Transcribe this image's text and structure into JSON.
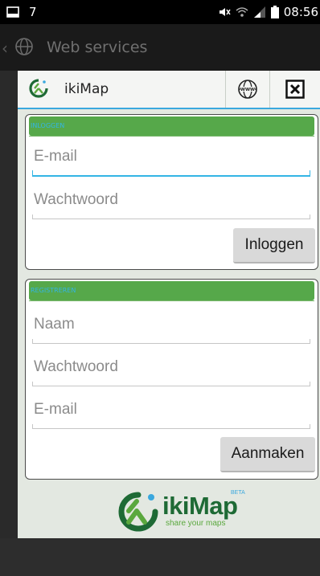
{
  "status_bar": {
    "left_text": "7",
    "time": "08:56",
    "icons": [
      "screenshot-icon",
      "mute-icon",
      "wifi-icon",
      "signal-icon",
      "battery-icon"
    ]
  },
  "action_bar": {
    "title": "Web services",
    "back_glyph": "‹",
    "icon": "globe-icon"
  },
  "dialog": {
    "title": "ikiMap",
    "logo_icon": "ikimap-logo-icon",
    "globe_button_icon": "www-globe-icon",
    "close_button_icon": "close-icon",
    "accent_color": "#33b5e5",
    "section_color": "#56a84a"
  },
  "login": {
    "section_label": "INLOGGEN",
    "email_placeholder": "E-mail",
    "password_placeholder": "Wachtwoord",
    "button_label": "Inloggen"
  },
  "register": {
    "section_label": "REGISTREREN",
    "name_placeholder": "Naam",
    "password_placeholder": "Wachtwoord",
    "email_placeholder": "E-mail",
    "button_label": "Aanmaken"
  },
  "brand": {
    "name": "ikiMap",
    "tagline": "share your maps",
    "badge": "BETA"
  }
}
